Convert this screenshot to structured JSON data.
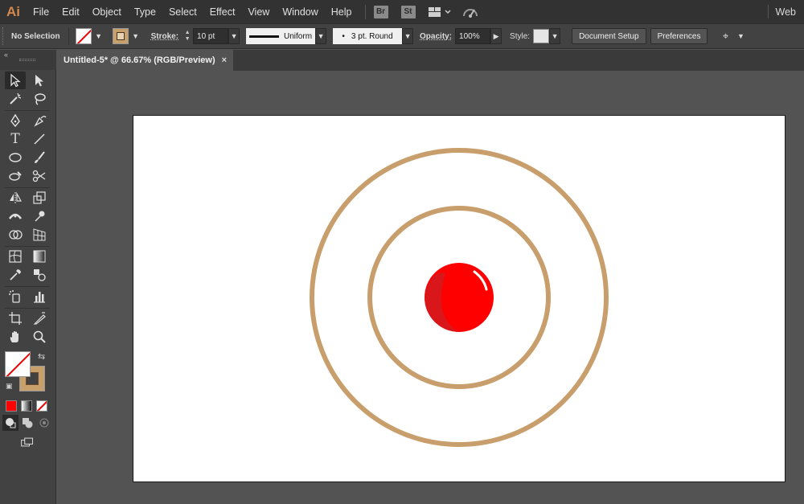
{
  "app": {
    "logo": "Ai",
    "workspace": "Web"
  },
  "menu": [
    "File",
    "Edit",
    "Object",
    "Type",
    "Select",
    "Effect",
    "View",
    "Window",
    "Help"
  ],
  "menubar_icons": {
    "bridge": "Br",
    "stock": "St",
    "arrange": "arrange-documents-icon",
    "gpu": "gpu-performance-icon"
  },
  "control": {
    "selection": "No Selection",
    "stroke_label": "Stroke:",
    "stroke_weight": "10 pt",
    "variable_width": "Uniform",
    "brush": "3 pt. Round",
    "opacity_label": "Opacity:",
    "opacity": "100%",
    "style_label": "Style:",
    "doc_setup": "Document Setup",
    "preferences": "Preferences"
  },
  "document": {
    "tab_title": "Untitled-5* @ 66.67% (RGB/Preview)",
    "close": "×"
  },
  "colors": {
    "fill": "none",
    "stroke": "#c89f6c",
    "ring": "#c89f6c",
    "ball": "#ff0000",
    "ball_shadow": "#d9161a",
    "highlight": "#ffffff"
  },
  "artwork": {
    "shapes": [
      "outer-ring",
      "inner-ring",
      "red-ball",
      "ball-shadow",
      "ball-highlight"
    ]
  }
}
